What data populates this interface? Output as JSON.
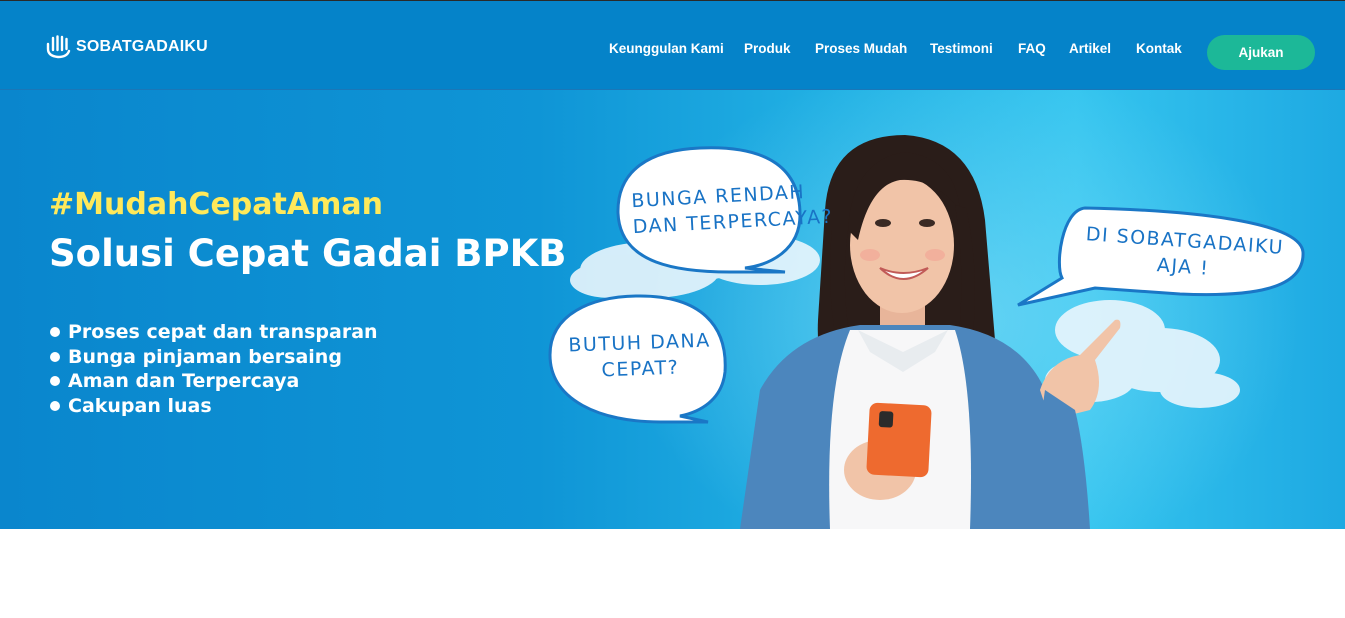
{
  "brand": {
    "name": "SOBATGADAIKU",
    "logo_icon": "hand-stripes-icon"
  },
  "nav": {
    "links": [
      "Keunggulan Kami",
      "Produk",
      "Proses Mudah",
      "Testimoni",
      "FAQ",
      "Artikel",
      "Kontak"
    ],
    "cta_label": "Ajukan"
  },
  "hero": {
    "tagline": "#MudahCepatAman",
    "headline": "Solusi Cepat Gadai BPKB",
    "bullets": [
      "Proses cepat dan transparan",
      "Bunga pinjaman bersaing",
      "Aman dan Terpercaya",
      "Cakupan luas"
    ],
    "bubbles": {
      "b1": {
        "line1": "BUNGA RENDAH",
        "line2": "DAN TERPERCAYA?"
      },
      "b2": {
        "line1": "BUTUH DANA",
        "line2": "CEPAT?"
      },
      "b3": {
        "line1": "DI SOBATGADAIKU",
        "line2": "AJA !"
      }
    }
  },
  "colors": {
    "nav_bg": "#0583c9",
    "cta_bg": "#1cb898",
    "tagline": "#ffe95a",
    "bubble_text": "#1973c5"
  }
}
